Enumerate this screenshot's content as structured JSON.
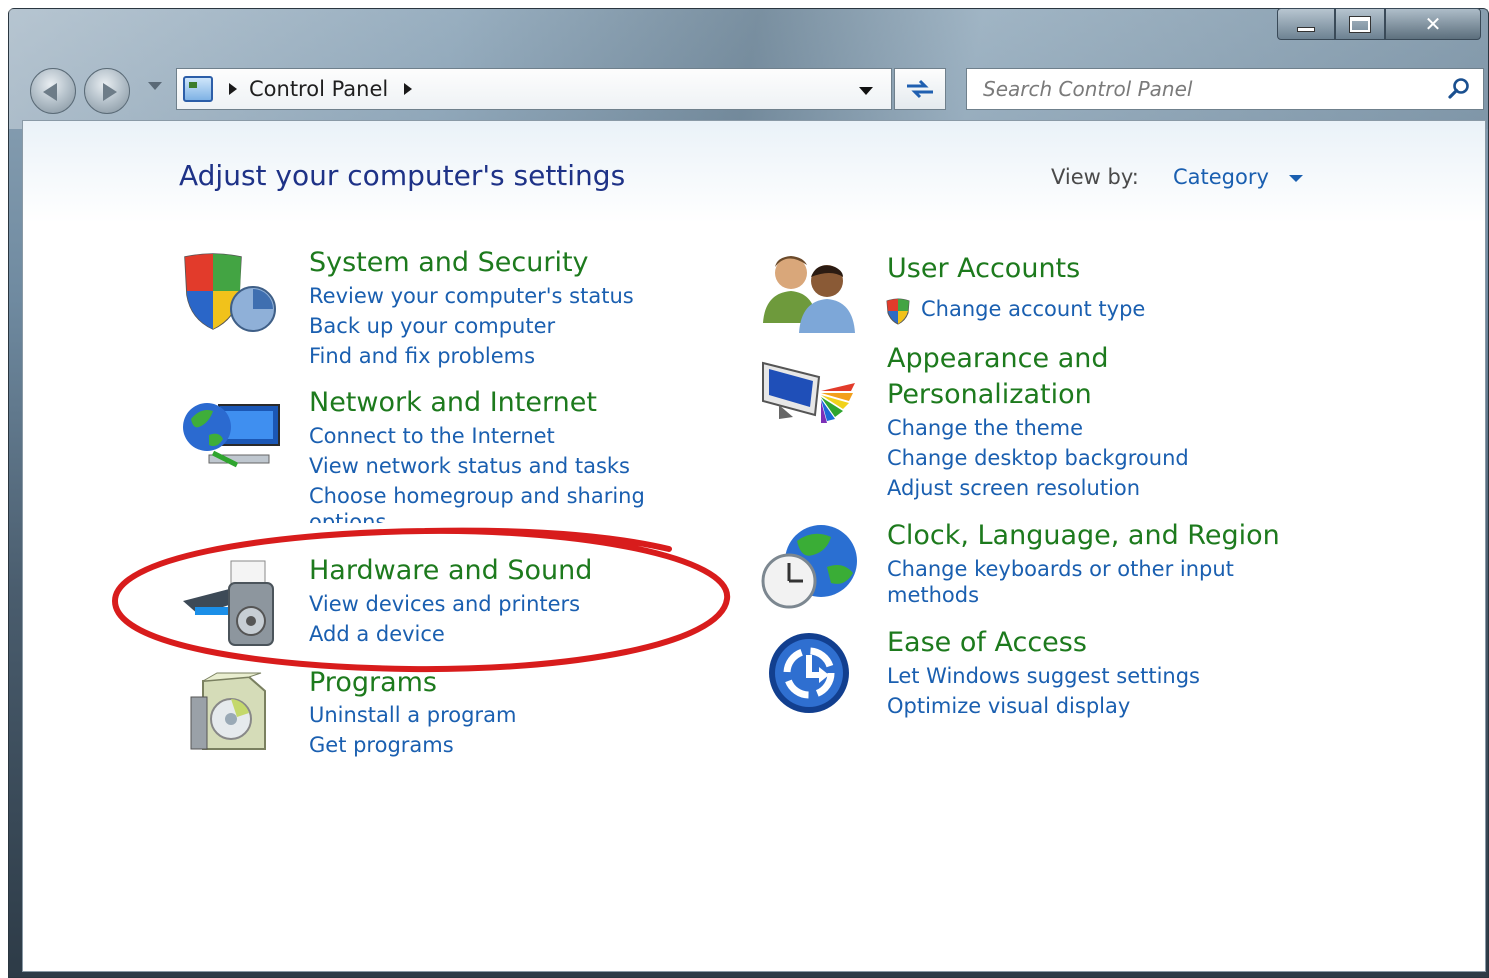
{
  "window": {
    "controls": {
      "minimize": "",
      "maximize": "",
      "close": "✕"
    }
  },
  "navbar": {
    "breadcrumb": "Control Panel",
    "search_placeholder": "Search Control Panel"
  },
  "header": {
    "title": "Adjust your computer's settings",
    "view_by_label": "View by:",
    "view_by_value": "Category"
  },
  "categories": {
    "system_security": {
      "title": "System and Security",
      "links": [
        "Review your computer's status",
        "Back up your computer",
        "Find and fix problems"
      ]
    },
    "network_internet": {
      "title": "Network and Internet",
      "links": [
        "Connect to the Internet",
        "View network status and tasks",
        "Choose homegroup and sharing",
        "options"
      ]
    },
    "hardware_sound": {
      "title": "Hardware and Sound",
      "links": [
        "View devices and printers",
        "Add a device"
      ]
    },
    "programs": {
      "title": "Programs",
      "links": [
        "Uninstall a program",
        "Get programs"
      ]
    },
    "user_accounts": {
      "title": "User Accounts",
      "links": [
        "Change account type"
      ]
    },
    "appearance": {
      "title_line1": "Appearance and",
      "title_line2": "Personalization",
      "links": [
        "Change the theme",
        "Change desktop background",
        "Adjust screen resolution"
      ]
    },
    "clock_language": {
      "title": "Clock, Language, and Region",
      "links": [
        "Change keyboards or other input",
        "methods"
      ]
    },
    "ease_of_access": {
      "title": "Ease of Access",
      "links": [
        "Let Windows suggest settings",
        "Optimize visual display"
      ]
    }
  },
  "annotation": {
    "color": "#d81c1c"
  }
}
